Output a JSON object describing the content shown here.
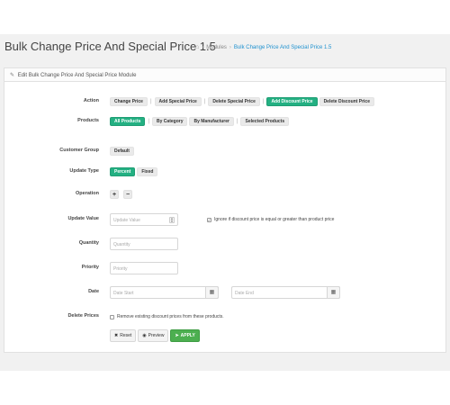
{
  "header": {
    "title": "Bulk Change Price And Special Price 1.5",
    "breadcrumb": {
      "home_icon": "home-icon",
      "separator": "›",
      "modules": "Modules",
      "current": "Bulk Change Price And Special Price 1.5"
    }
  },
  "panel": {
    "heading": "Edit Bulk Change Price And Special Price Module",
    "heading_icon": "pencil-icon"
  },
  "form": {
    "action": {
      "label": "Action",
      "options": [
        "Change Price",
        "Add Special Price",
        "Delete Special Price",
        "Add Discount Price",
        "Delete Discount Price"
      ],
      "selected": "Add Discount Price"
    },
    "products": {
      "label": "Products",
      "options": [
        "All Products",
        "By Category",
        "By Manufacturer",
        "Selected Products"
      ],
      "selected": "All Products"
    },
    "customer_group": {
      "label": "Customer Group",
      "value": "Default"
    },
    "update_type": {
      "label": "Update Type",
      "options": [
        "Percent",
        "Fixed"
      ],
      "selected": "Percent"
    },
    "operation": {
      "label": "Operation",
      "plus": "+",
      "minus": "−"
    },
    "update_value": {
      "label": "Update Value",
      "placeholder": "Update Value",
      "ignore_text": "Ignore if discount price is equal or greater than product price",
      "ignore_checked": true
    },
    "quantity": {
      "label": "Quantity",
      "placeholder": "Quantity"
    },
    "priority": {
      "label": "Priority",
      "placeholder": "Priority"
    },
    "date": {
      "label": "Date",
      "start_placeholder": "Date Start",
      "end_placeholder": "Date End",
      "icon": "calendar-icon"
    },
    "delete_prices": {
      "label": "Delete Prices",
      "text": "Remove existing discount prices from these products.",
      "checked": false
    }
  },
  "actions": {
    "reset": "Reset",
    "preview": "Preview",
    "apply": "APPLY",
    "colors": {
      "apply": "#4caf50",
      "active": "#23b082",
      "link": "#1e91cf"
    }
  }
}
